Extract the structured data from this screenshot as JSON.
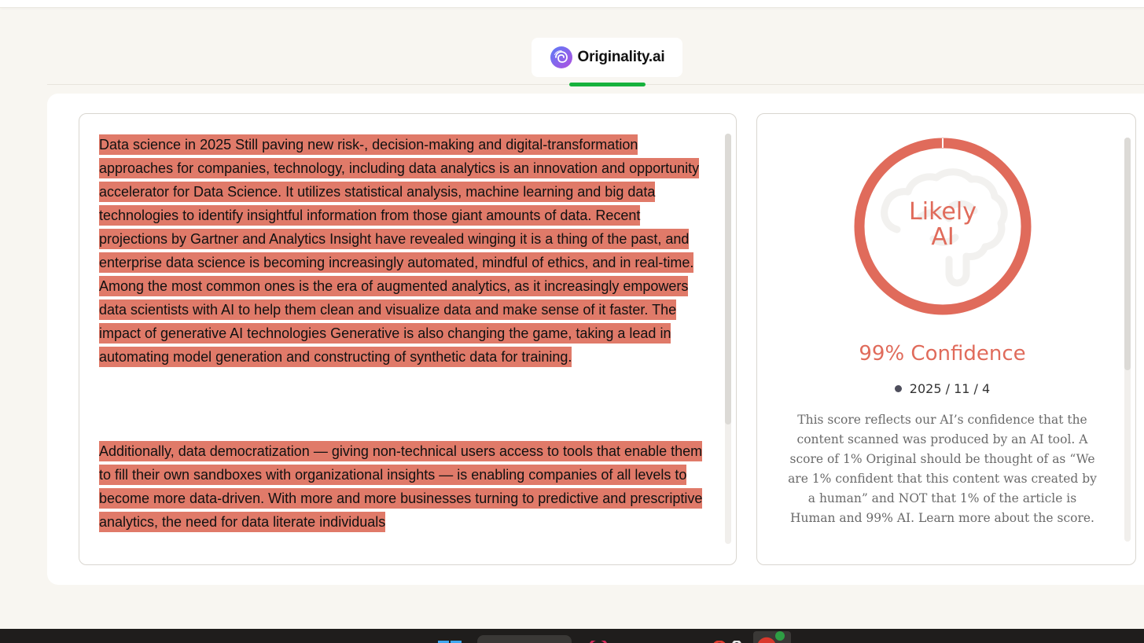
{
  "brand": {
    "name": "Originality.ai",
    "logo_icon": "brain-spiral-icon",
    "accent": "#16b23d"
  },
  "document": {
    "highlight_color": "#e07a69",
    "paragraphs": [
      " Data science in 2025 Still paving new risk-, decision-making and digital-transformation approaches for companies, technology, including data analytics is an innovation and opportunity accelerator for Data Science.  It utilizes statistical analysis, machine learning and big data technologies to identify insightful information from those giant amounts of data.  Recent projections by Gartner and Analytics Insight have revealed winging it is a thing of the past, and enterprise data science is becoming increasingly automated, mindful of ethics, and in real-time.  Among the most common ones is the era of augmented analytics, as it increasingly empowers data scientists with AI to help them clean and visualize data and make sense of it faster.  The impact of generative AI technologies Generative is also changing the game, taking a lead in automating model generation and constructing of synthetic data for training. ",
      " Additionally, data democratization — giving non-technical users access to tools that enable them to fill their own sandboxes with organizational insights — is enabling companies of all levels to become more data-driven.  With more and more businesses turning to predictive and prescriptive analytics, the need for data literate individuals"
    ]
  },
  "result": {
    "verdict_line_1": "Likely",
    "verdict_line_2": "AI",
    "score_percent": 99,
    "confidence_text": "99% Confidence",
    "date": "2025 / 11 / 4",
    "explanation": "This score reflects our AI’s confidence that the content scanned was produced by an AI tool. A score of 1% Original should be thought of as “We are 1% confident that this content was created by a human” and NOT that 1% of the article is Human and 99% AI. Learn more about the score.",
    "ring_color": "#e06b5b",
    "ring_bg_icon": "brain-icon"
  },
  "taskbar": {
    "icons": [
      "windows-start-icon",
      "search-box",
      "browser-app-icon",
      "files-app-icon",
      "extension-app-icon",
      "active-app-icon"
    ]
  }
}
